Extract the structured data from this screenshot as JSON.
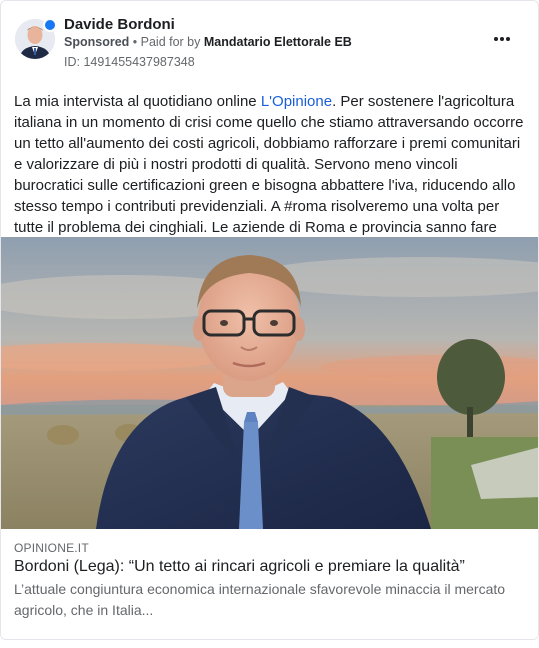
{
  "post": {
    "author": "Davide Bordoni",
    "sponsored_label": "Sponsored",
    "separator": " • ",
    "paid_for_prefix": "Paid for by ",
    "payer": "Mandatario Elettorale EB",
    "ad_id": "ID: 1491455437987348",
    "more_icon": "more-horizontal-icon",
    "text_before_link": "La mia intervista al quotidiano online ",
    "text_link": "L'Opinione",
    "text_after_link": ". Per sostenere l'agricoltura italiana in un momento di crisi come quello che stiamo attraversando occorre un tetto all'aumento dei costi agricoli, dobbiamo rafforzare i premi comunitari e valorizzare di più i nostri prodotti di qualità. Servono meno vincoli burocratici sulle certificazioni green e bisogna abbattere l'iva, riducendo allo stesso tempo i contributi previdenziali. A #roma risolveremo una volta per tutte il problema dei cinghiali. Le aziende di Roma e provincia sanno fare agricoltura. Abbiamo..."
  },
  "link_preview": {
    "domain": "OPINIONE.IT",
    "title": "Bordoni (Lega): “Un tetto ai rincari agricoli e premiare la qualità”",
    "description": "L’attuale congiuntura economica internazionale sfavorevole minaccia il mercato agricolo, che in Italia..."
  },
  "colors": {
    "link": "#1a5fd8",
    "secondary_text": "#65676b",
    "primary_text": "#1c1e21",
    "border": "#e4e6eb"
  }
}
